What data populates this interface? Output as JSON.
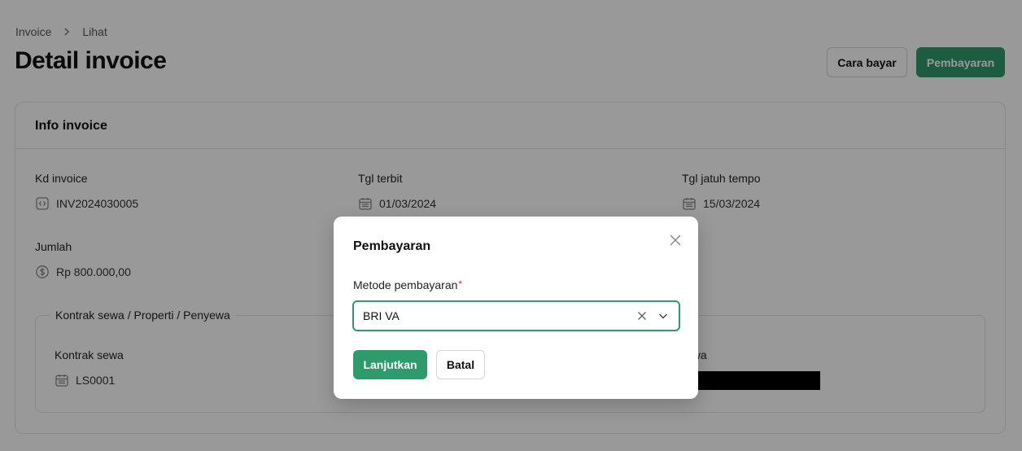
{
  "breadcrumb": {
    "parent": "Invoice",
    "current": "Lihat"
  },
  "page_title": "Detail invoice",
  "header_actions": {
    "secondary_label": "Cara bayar",
    "primary_label": "Pembayaran"
  },
  "card": {
    "title": "Info invoice",
    "fields": {
      "kd_invoice": {
        "label": "Kd invoice",
        "value": "INV2024030005",
        "icon": "code-icon"
      },
      "tgl_terbit": {
        "label": "Tgl terbit",
        "value": "01/03/2024",
        "icon": "calendar-icon"
      },
      "tgl_jatuh_tempo": {
        "label": "Tgl jatuh tempo",
        "value": "15/03/2024",
        "icon": "calendar-icon"
      },
      "jumlah": {
        "label": "Jumlah",
        "value": "Rp 800.000,00",
        "icon": "dollar-icon"
      }
    },
    "group": {
      "legend": "Kontrak sewa / Properti / Penyewa",
      "kontrak_sewa": {
        "label": "Kontrak sewa",
        "value": "LS0001",
        "icon": "calendar-icon"
      },
      "penyewa": {
        "label": "ewa"
      }
    }
  },
  "modal": {
    "title": "Pembayaran",
    "field_label": "Metode pembayaran",
    "required_mark": "*",
    "selected_value": "BRI VA",
    "confirm_label": "Lanjutkan",
    "cancel_label": "Batal"
  },
  "colors": {
    "primary": "#2f9a6b",
    "required": "#e03131"
  }
}
